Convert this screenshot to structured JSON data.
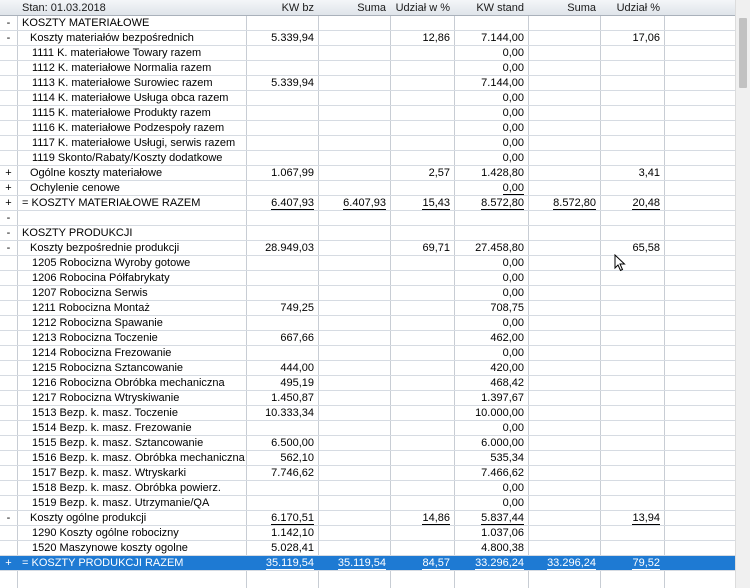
{
  "header": {
    "stan": "Stan: 01.03.2018",
    "cols": [
      "KW bz",
      "Suma",
      "Udział w %",
      "KW stand",
      "Suma",
      "Udział %"
    ]
  },
  "rows": [
    {
      "exp": "-",
      "name": "KOSZTY MATERIAŁOWE",
      "indent": 0,
      "v": [
        "",
        "",
        "",
        "",
        "",
        ""
      ]
    },
    {
      "exp": "-",
      "name": "Koszty materiałów bezpośrednich",
      "indent": 1,
      "v": [
        "5.339,94",
        "",
        "12,86",
        "7.144,00",
        "",
        "17,06"
      ]
    },
    {
      "exp": "",
      "name": "1111 K. materiałowe Towary razem",
      "indent": 2,
      "v": [
        "",
        "",
        "",
        "0,00",
        "",
        ""
      ]
    },
    {
      "exp": "",
      "name": "1112 K. materiałowe Normalia razem",
      "indent": 2,
      "v": [
        "",
        "",
        "",
        "0,00",
        "",
        ""
      ]
    },
    {
      "exp": "",
      "name": "1113 K. materiałowe Surowiec razem",
      "indent": 2,
      "v": [
        "5.339,94",
        "",
        "",
        "7.144,00",
        "",
        ""
      ]
    },
    {
      "exp": "",
      "name": "1114 K. materiałowe Usługa obca razem",
      "indent": 2,
      "v": [
        "",
        "",
        "",
        "0,00",
        "",
        ""
      ]
    },
    {
      "exp": "",
      "name": "1115 K. materiałowe Produkty razem",
      "indent": 2,
      "v": [
        "",
        "",
        "",
        "0,00",
        "",
        ""
      ]
    },
    {
      "exp": "",
      "name": "1116 K. materiałowe Podzespoły razem",
      "indent": 2,
      "v": [
        "",
        "",
        "",
        "0,00",
        "",
        ""
      ]
    },
    {
      "exp": "",
      "name": "1117 K. materiałowe Usługi, serwis razem",
      "indent": 2,
      "v": [
        "",
        "",
        "",
        "0,00",
        "",
        ""
      ]
    },
    {
      "exp": "",
      "name": "1119 Skonto/Rabaty/Koszty dodatkowe",
      "indent": 2,
      "v": [
        "",
        "",
        "",
        "0,00",
        "",
        ""
      ]
    },
    {
      "exp": "+",
      "name": "Ogólne koszty materiałowe",
      "indent": 1,
      "v": [
        "1.067,99",
        "",
        "2,57",
        "1.428,80",
        "",
        "3,41"
      ]
    },
    {
      "exp": "+",
      "name": "Ochylenie cenowe",
      "indent": 1,
      "v": [
        "",
        "",
        "",
        "0,00",
        "",
        ""
      ],
      "ul": [
        0,
        0,
        0,
        1,
        0,
        0
      ]
    },
    {
      "exp": "+",
      "name": "= KOSZTY MATERIAŁOWE RAZEM",
      "indent": 0,
      "v": [
        "6.407,93",
        "6.407,93",
        "15,43",
        "8.572,80",
        "8.572,80",
        "20,48"
      ],
      "dul": [
        1,
        1,
        1,
        1,
        1,
        1
      ]
    },
    {
      "exp": "-",
      "name": "",
      "indent": 0,
      "v": [
        "",
        "",
        "",
        "",
        "",
        ""
      ]
    },
    {
      "exp": "-",
      "name": "KOSZTY PRODUKCJI",
      "indent": 0,
      "v": [
        "",
        "",
        "",
        "",
        "",
        ""
      ]
    },
    {
      "exp": "-",
      "name": "Koszty bezpośrednie produkcji",
      "indent": 1,
      "v": [
        "28.949,03",
        "",
        "69,71",
        "27.458,80",
        "",
        "65,58"
      ]
    },
    {
      "exp": "",
      "name": "1205 Robocizna Wyroby gotowe",
      "indent": 2,
      "v": [
        "",
        "",
        "",
        "0,00",
        "",
        ""
      ]
    },
    {
      "exp": "",
      "name": "1206 Robocina Półfabrykaty",
      "indent": 2,
      "v": [
        "",
        "",
        "",
        "0,00",
        "",
        ""
      ]
    },
    {
      "exp": "",
      "name": "1207 Robocizna Serwis",
      "indent": 2,
      "v": [
        "",
        "",
        "",
        "0,00",
        "",
        ""
      ]
    },
    {
      "exp": "",
      "name": "1211 Robocizna Montaż",
      "indent": 2,
      "v": [
        "749,25",
        "",
        "",
        "708,75",
        "",
        ""
      ]
    },
    {
      "exp": "",
      "name": "1212 Robocizna Spawanie",
      "indent": 2,
      "v": [
        "",
        "",
        "",
        "0,00",
        "",
        ""
      ]
    },
    {
      "exp": "",
      "name": "1213 Robocizna Toczenie",
      "indent": 2,
      "v": [
        "667,66",
        "",
        "",
        "462,00",
        "",
        ""
      ]
    },
    {
      "exp": "",
      "name": "1214 Robocizna Frezowanie",
      "indent": 2,
      "v": [
        "",
        "",
        "",
        "0,00",
        "",
        ""
      ]
    },
    {
      "exp": "",
      "name": "1215 Robocizna Sztancowanie",
      "indent": 2,
      "v": [
        "444,00",
        "",
        "",
        "420,00",
        "",
        ""
      ]
    },
    {
      "exp": "",
      "name": "1216 Robocizna Obróbka mechaniczna",
      "indent": 2,
      "v": [
        "495,19",
        "",
        "",
        "468,42",
        "",
        ""
      ]
    },
    {
      "exp": "",
      "name": "1217 Robocizna Wtryskiwanie",
      "indent": 2,
      "v": [
        "1.450,87",
        "",
        "",
        "1.397,67",
        "",
        ""
      ]
    },
    {
      "exp": "",
      "name": "1513 Bezp. k. masz. Toczenie",
      "indent": 2,
      "v": [
        "10.333,34",
        "",
        "",
        "10.000,00",
        "",
        ""
      ]
    },
    {
      "exp": "",
      "name": "1514 Bezp. k. masz. Frezowanie",
      "indent": 2,
      "v": [
        "",
        "",
        "",
        "0,00",
        "",
        ""
      ]
    },
    {
      "exp": "",
      "name": "1515 Bezp. k. masz. Sztancowanie",
      "indent": 2,
      "v": [
        "6.500,00",
        "",
        "",
        "6.000,00",
        "",
        ""
      ]
    },
    {
      "exp": "",
      "name": "1516 Bezp. k. masz. Obróbka mechaniczna",
      "indent": 2,
      "v": [
        "562,10",
        "",
        "",
        "535,34",
        "",
        ""
      ]
    },
    {
      "exp": "",
      "name": "1517 Bezp. k. masz. Wtryskarki",
      "indent": 2,
      "v": [
        "7.746,62",
        "",
        "",
        "7.466,62",
        "",
        ""
      ]
    },
    {
      "exp": "",
      "name": "1518 Bezp. k. masz. Obróbka powierz.",
      "indent": 2,
      "v": [
        "",
        "",
        "",
        "0,00",
        "",
        ""
      ]
    },
    {
      "exp": "",
      "name": "1519 Bezp. k. masz. Utrzymanie/QA",
      "indent": 2,
      "v": [
        "",
        "",
        "",
        "0,00",
        "",
        ""
      ]
    },
    {
      "exp": "-",
      "name": "Koszty ogólne produkcji",
      "indent": 1,
      "v": [
        "6.170,51",
        "",
        "14,86",
        "5.837,44",
        "",
        "13,94"
      ],
      "ul": [
        1,
        0,
        1,
        1,
        0,
        1
      ]
    },
    {
      "exp": "",
      "name": "1290 Koszty ogólne robocizny",
      "indent": 2,
      "v": [
        "1.142,10",
        "",
        "",
        "1.037,06",
        "",
        ""
      ]
    },
    {
      "exp": "",
      "name": "1520 Maszynowe koszty ogolne",
      "indent": 2,
      "v": [
        "5.028,41",
        "",
        "",
        "4.800,38",
        "",
        ""
      ]
    },
    {
      "exp": "+",
      "name": "= KOSZTY PRODUKCJI RAZEM",
      "indent": 0,
      "v": [
        "35.119,54",
        "35.119,54",
        "84,57",
        "33.296,24",
        "33.296,24",
        "79,52"
      ],
      "dul": [
        1,
        1,
        1,
        1,
        1,
        1
      ],
      "selected": true
    }
  ],
  "colors": {
    "selected": "#1e7ad3",
    "header": "#dfe4ea",
    "gridline": "#d6dbe2"
  },
  "icons": {
    "cursor": "mouse-pointer-icon"
  }
}
